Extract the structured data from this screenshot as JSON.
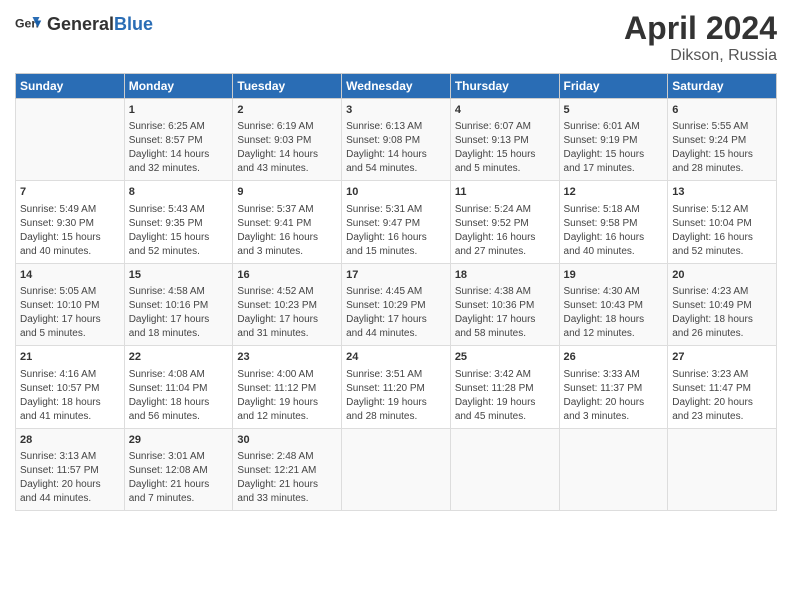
{
  "header": {
    "logo_general": "General",
    "logo_blue": "Blue",
    "title": "April 2024",
    "subtitle": "Dikson, Russia"
  },
  "days_of_week": [
    "Sunday",
    "Monday",
    "Tuesday",
    "Wednesday",
    "Thursday",
    "Friday",
    "Saturday"
  ],
  "weeks": [
    [
      {
        "day": "",
        "info": ""
      },
      {
        "day": "1",
        "info": "Sunrise: 6:25 AM\nSunset: 8:57 PM\nDaylight: 14 hours\nand 32 minutes."
      },
      {
        "day": "2",
        "info": "Sunrise: 6:19 AM\nSunset: 9:03 PM\nDaylight: 14 hours\nand 43 minutes."
      },
      {
        "day": "3",
        "info": "Sunrise: 6:13 AM\nSunset: 9:08 PM\nDaylight: 14 hours\nand 54 minutes."
      },
      {
        "day": "4",
        "info": "Sunrise: 6:07 AM\nSunset: 9:13 PM\nDaylight: 15 hours\nand 5 minutes."
      },
      {
        "day": "5",
        "info": "Sunrise: 6:01 AM\nSunset: 9:19 PM\nDaylight: 15 hours\nand 17 minutes."
      },
      {
        "day": "6",
        "info": "Sunrise: 5:55 AM\nSunset: 9:24 PM\nDaylight: 15 hours\nand 28 minutes."
      }
    ],
    [
      {
        "day": "7",
        "info": "Sunrise: 5:49 AM\nSunset: 9:30 PM\nDaylight: 15 hours\nand 40 minutes."
      },
      {
        "day": "8",
        "info": "Sunrise: 5:43 AM\nSunset: 9:35 PM\nDaylight: 15 hours\nand 52 minutes."
      },
      {
        "day": "9",
        "info": "Sunrise: 5:37 AM\nSunset: 9:41 PM\nDaylight: 16 hours\nand 3 minutes."
      },
      {
        "day": "10",
        "info": "Sunrise: 5:31 AM\nSunset: 9:47 PM\nDaylight: 16 hours\nand 15 minutes."
      },
      {
        "day": "11",
        "info": "Sunrise: 5:24 AM\nSunset: 9:52 PM\nDaylight: 16 hours\nand 27 minutes."
      },
      {
        "day": "12",
        "info": "Sunrise: 5:18 AM\nSunset: 9:58 PM\nDaylight: 16 hours\nand 40 minutes."
      },
      {
        "day": "13",
        "info": "Sunrise: 5:12 AM\nSunset: 10:04 PM\nDaylight: 16 hours\nand 52 minutes."
      }
    ],
    [
      {
        "day": "14",
        "info": "Sunrise: 5:05 AM\nSunset: 10:10 PM\nDaylight: 17 hours\nand 5 minutes."
      },
      {
        "day": "15",
        "info": "Sunrise: 4:58 AM\nSunset: 10:16 PM\nDaylight: 17 hours\nand 18 minutes."
      },
      {
        "day": "16",
        "info": "Sunrise: 4:52 AM\nSunset: 10:23 PM\nDaylight: 17 hours\nand 31 minutes."
      },
      {
        "day": "17",
        "info": "Sunrise: 4:45 AM\nSunset: 10:29 PM\nDaylight: 17 hours\nand 44 minutes."
      },
      {
        "day": "18",
        "info": "Sunrise: 4:38 AM\nSunset: 10:36 PM\nDaylight: 17 hours\nand 58 minutes."
      },
      {
        "day": "19",
        "info": "Sunrise: 4:30 AM\nSunset: 10:43 PM\nDaylight: 18 hours\nand 12 minutes."
      },
      {
        "day": "20",
        "info": "Sunrise: 4:23 AM\nSunset: 10:49 PM\nDaylight: 18 hours\nand 26 minutes."
      }
    ],
    [
      {
        "day": "21",
        "info": "Sunrise: 4:16 AM\nSunset: 10:57 PM\nDaylight: 18 hours\nand 41 minutes."
      },
      {
        "day": "22",
        "info": "Sunrise: 4:08 AM\nSunset: 11:04 PM\nDaylight: 18 hours\nand 56 minutes."
      },
      {
        "day": "23",
        "info": "Sunrise: 4:00 AM\nSunset: 11:12 PM\nDaylight: 19 hours\nand 12 minutes."
      },
      {
        "day": "24",
        "info": "Sunrise: 3:51 AM\nSunset: 11:20 PM\nDaylight: 19 hours\nand 28 minutes."
      },
      {
        "day": "25",
        "info": "Sunrise: 3:42 AM\nSunset: 11:28 PM\nDaylight: 19 hours\nand 45 minutes."
      },
      {
        "day": "26",
        "info": "Sunrise: 3:33 AM\nSunset: 11:37 PM\nDaylight: 20 hours\nand 3 minutes."
      },
      {
        "day": "27",
        "info": "Sunrise: 3:23 AM\nSunset: 11:47 PM\nDaylight: 20 hours\nand 23 minutes."
      }
    ],
    [
      {
        "day": "28",
        "info": "Sunrise: 3:13 AM\nSunset: 11:57 PM\nDaylight: 20 hours\nand 44 minutes."
      },
      {
        "day": "29",
        "info": "Sunrise: 3:01 AM\nSunset: 12:08 AM\nDaylight: 21 hours\nand 7 minutes."
      },
      {
        "day": "30",
        "info": "Sunrise: 2:48 AM\nSunset: 12:21 AM\nDaylight: 21 hours\nand 33 minutes."
      },
      {
        "day": "",
        "info": ""
      },
      {
        "day": "",
        "info": ""
      },
      {
        "day": "",
        "info": ""
      },
      {
        "day": "",
        "info": ""
      }
    ]
  ]
}
